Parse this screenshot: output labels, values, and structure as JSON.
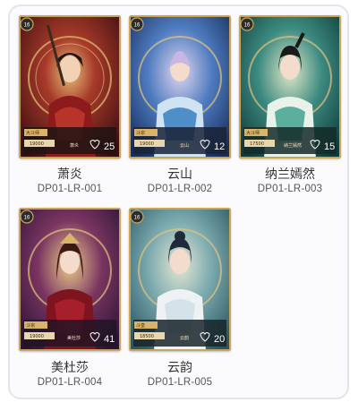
{
  "cards": [
    {
      "name": "萧炎",
      "code": "DP01-LR-001",
      "count": "25",
      "power": "19000",
      "title": "大斗师",
      "footer": "萧炎",
      "badge": "16"
    },
    {
      "name": "云山",
      "code": "DP01-LR-002",
      "count": "12",
      "power": "19000",
      "title": "斗宗",
      "footer": "云山",
      "badge": "16"
    },
    {
      "name": "纳兰嫣然",
      "code": "DP01-LR-003",
      "count": "15",
      "power": "17500",
      "title": "大斗师",
      "footer": "纳兰嫣然",
      "badge": "16"
    },
    {
      "name": "美杜莎",
      "code": "DP01-LR-004",
      "count": "41",
      "power": "19000",
      "title": "斗宗",
      "footer": "美杜莎",
      "badge": "16"
    },
    {
      "name": "云韵",
      "code": "DP01-LR-005",
      "count": "20",
      "power": "18500",
      "title": "斗皇",
      "footer": "云韵",
      "badge": "16"
    }
  ],
  "colors": {
    "card1_bg": "#7a1e1c",
    "card2_bg": "#2c4f8c",
    "card3_bg": "#1f5a57",
    "card4_bg": "#4a2a5e",
    "card5_bg": "#4c7b86",
    "gold": "#c9a55a"
  }
}
